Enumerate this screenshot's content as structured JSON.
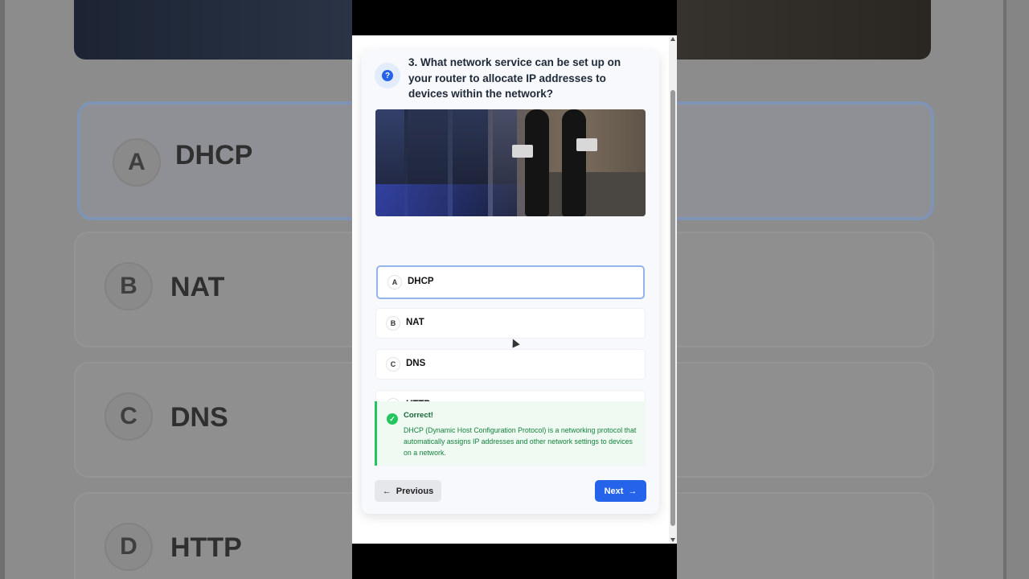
{
  "question": {
    "icon": "question-icon",
    "text": "3. What network service can be set up on your router to allocate IP addresses to devices within the network?"
  },
  "options": [
    {
      "letter": "A",
      "label": "DHCP",
      "selected": true
    },
    {
      "letter": "B",
      "label": "NAT",
      "selected": false
    },
    {
      "letter": "C",
      "label": "DNS",
      "selected": false
    },
    {
      "letter": "D",
      "label": "HTTP",
      "selected": false
    }
  ],
  "feedback": {
    "title": "Correct!",
    "text": "DHCP (Dynamic Host Configuration Protocol) is a networking protocol that automatically assigns IP addresses and other network settings to devices on a network."
  },
  "navigation": {
    "previous_label": "Previous",
    "next_label": "Next"
  },
  "colors": {
    "accent": "#2563eb",
    "success": "#22c55e",
    "selected_border": "#93b4ec"
  }
}
